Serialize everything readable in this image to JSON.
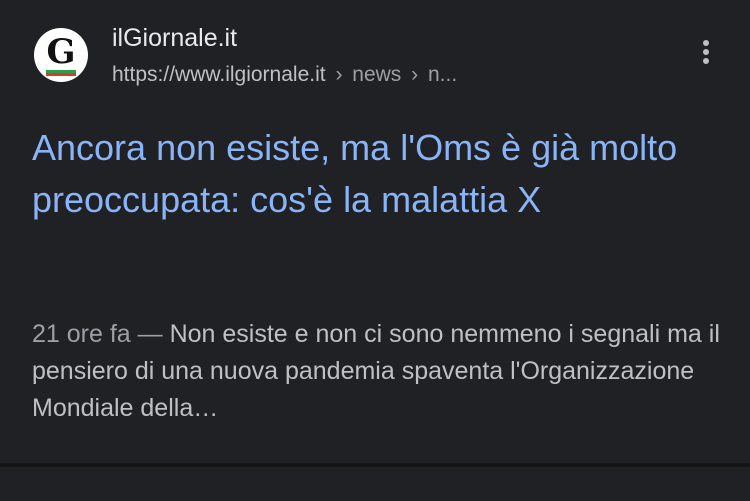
{
  "result": {
    "favicon_letter": "G",
    "site_name": "ilGiornale.it",
    "url_base": "https://www.ilgiornale.it",
    "breadcrumb_sep": "›",
    "crumb_1": "news",
    "crumb_2": "n...",
    "more_icon": "more-vert-icon",
    "title": "Ancora non esiste, ma l'Oms è già molto preoccupata: cos'è la malattia X",
    "date": "21 ore fa",
    "dash": "—",
    "snippet": "Non esiste e non ci sono nemmeno i segnali ma il pensiero di una nuova pandemia spaventa l'Organizzazione Mondiale della…"
  },
  "colors": {
    "background": "#202124",
    "title_link": "#8ab4f8",
    "primary_text": "#e8eaed",
    "secondary_text": "#bdc1c6"
  }
}
